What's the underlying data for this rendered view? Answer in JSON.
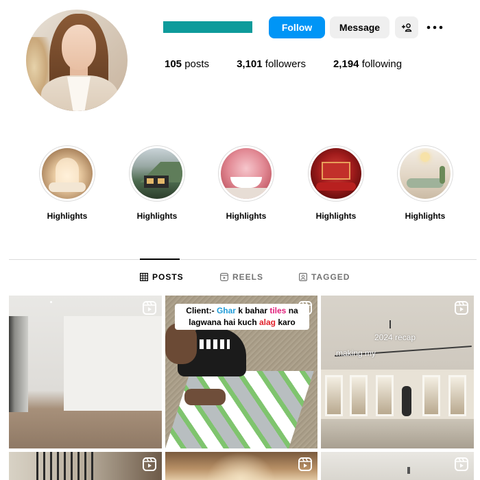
{
  "profile": {
    "follow_label": "Follow",
    "message_label": "Message",
    "stats": {
      "posts_count": "105",
      "posts_label": "posts",
      "followers_count": "3,101",
      "followers_label": "followers",
      "following_count": "2,194",
      "following_label": "following"
    },
    "name_redaction_color": "#0e9b9b"
  },
  "highlights": [
    {
      "label": "Highlights"
    },
    {
      "label": "Highlights"
    },
    {
      "label": "Highlights"
    },
    {
      "label": "Highlights"
    },
    {
      "label": "Highlights"
    }
  ],
  "tabs": [
    {
      "label": "POSTS",
      "icon": "grid-icon",
      "active": true
    },
    {
      "label": "REELS",
      "icon": "reels-icon",
      "active": false
    },
    {
      "label": "TAGGED",
      "icon": "tagged-icon",
      "active": false
    }
  ],
  "posts": [
    {
      "type": "reel"
    },
    {
      "type": "reel",
      "caption": {
        "w1": "Client:-",
        "w2": "Ghar",
        "w3": "k bahar",
        "w4": "tiles",
        "w5": "na",
        "w6": "lagwana hai kuch",
        "w7": "alag",
        "w8": "karo"
      }
    },
    {
      "type": "reel",
      "overlay": [
        "2024 recap",
        "making my"
      ]
    },
    {
      "type": "reel"
    },
    {
      "type": "reel"
    },
    {
      "type": "reel"
    }
  ],
  "colors": {
    "accent": "#0095f6",
    "secondary_button": "#efefef",
    "divider": "#dbdbdb",
    "muted_text": "#737373"
  }
}
